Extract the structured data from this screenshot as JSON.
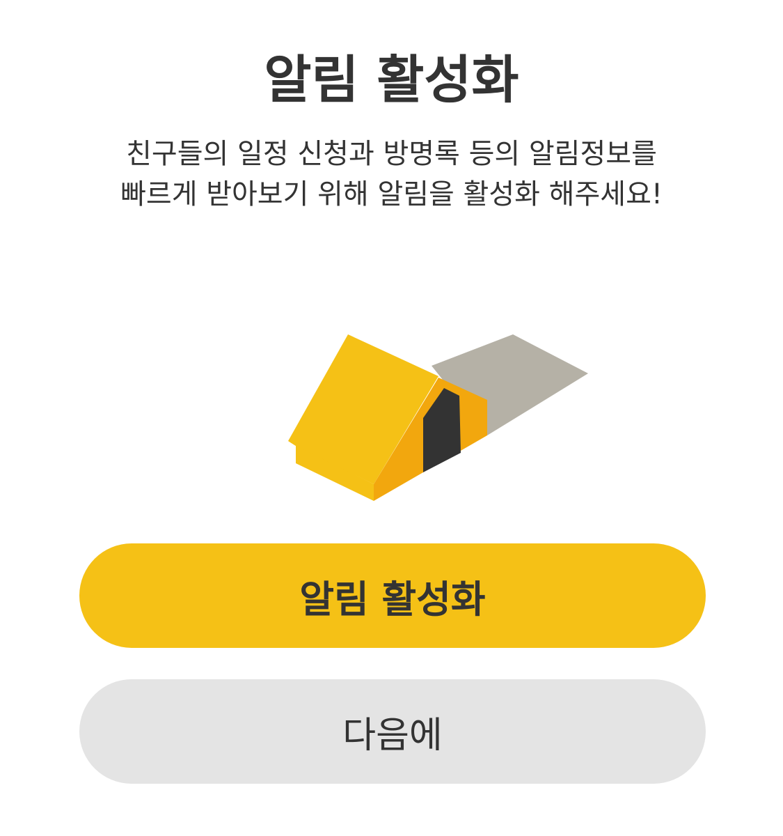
{
  "header": {
    "title": "알림 활성화"
  },
  "description": {
    "line1": "친구들의 일정 신청과 방명록 등의 알림정보를",
    "line2": "빠르게 받아보기 위해 알림을 활성화 해주세요!"
  },
  "illustration": {
    "icon": "tent-icon",
    "colors": {
      "tent_body": "#F5C116",
      "tent_side": "#F2A70E",
      "door": "#333333",
      "shadow": "#B5B1A6"
    }
  },
  "actions": {
    "enable_label": "알림 활성화",
    "later_label": "다음에"
  },
  "colors": {
    "primary": "#F5C116",
    "secondary": "#E4E4E4",
    "text": "#333333",
    "background": "#FFFFFF"
  }
}
